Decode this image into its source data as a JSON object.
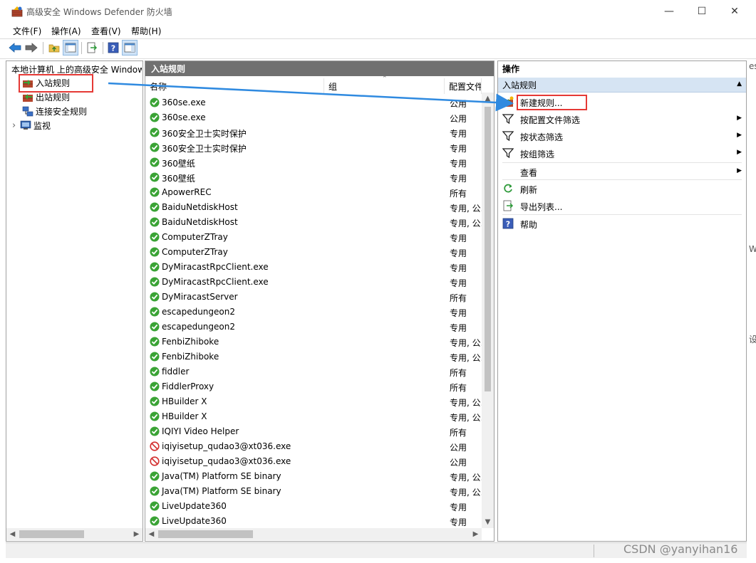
{
  "window": {
    "title": "高级安全 Windows Defender 防火墙",
    "minimize_glyph": "—",
    "maximize_glyph": "☐",
    "close_glyph": "✕"
  },
  "menu": [
    {
      "label": "文件(F)"
    },
    {
      "label": "操作(A)"
    },
    {
      "label": "查看(V)"
    },
    {
      "label": "帮助(H)"
    }
  ],
  "tree": {
    "root": "本地计算机 上的高级安全 Windows Defender 防火墙",
    "items": [
      {
        "label": "入站规则"
      },
      {
        "label": "出站规则"
      },
      {
        "label": "连接安全规则"
      },
      {
        "label": "监视"
      }
    ],
    "expander_glyph": "›"
  },
  "rules_pane": {
    "title": "入站规则",
    "columns": {
      "name": "名称",
      "group": "组",
      "profile": "配置文件"
    },
    "rows": [
      {
        "name": "360se.exe",
        "profile": "公用",
        "status": "allow"
      },
      {
        "name": "360se.exe",
        "profile": "公用",
        "status": "allow"
      },
      {
        "name": "360安全卫士实时保护",
        "profile": "专用",
        "status": "allow"
      },
      {
        "name": "360安全卫士实时保护",
        "profile": "专用",
        "status": "allow"
      },
      {
        "name": "360壁纸",
        "profile": "专用",
        "status": "allow"
      },
      {
        "name": "360壁纸",
        "profile": "专用",
        "status": "allow"
      },
      {
        "name": "ApowerREC",
        "profile": "所有",
        "status": "allow"
      },
      {
        "name": "BaiduNetdiskHost",
        "profile": "专用, 公...",
        "status": "allow"
      },
      {
        "name": "BaiduNetdiskHost",
        "profile": "专用, 公...",
        "status": "allow"
      },
      {
        "name": "ComputerZTray",
        "profile": "专用",
        "status": "allow"
      },
      {
        "name": "ComputerZTray",
        "profile": "专用",
        "status": "allow"
      },
      {
        "name": "DyMiracastRpcClient.exe",
        "profile": "专用",
        "status": "allow"
      },
      {
        "name": "DyMiracastRpcClient.exe",
        "profile": "专用",
        "status": "allow"
      },
      {
        "name": "DyMiracastServer",
        "profile": "所有",
        "status": "allow"
      },
      {
        "name": "escapedungeon2",
        "profile": "专用",
        "status": "allow"
      },
      {
        "name": "escapedungeon2",
        "profile": "专用",
        "status": "allow"
      },
      {
        "name": "FenbiZhiboke",
        "profile": "专用, 公...",
        "status": "allow"
      },
      {
        "name": "FenbiZhiboke",
        "profile": "专用, 公...",
        "status": "allow"
      },
      {
        "name": "fiddler",
        "profile": "所有",
        "status": "allow"
      },
      {
        "name": "FiddlerProxy",
        "profile": "所有",
        "status": "allow"
      },
      {
        "name": "HBuilder X",
        "profile": "专用, 公...",
        "status": "allow"
      },
      {
        "name": "HBuilder X",
        "profile": "专用, 公...",
        "status": "allow"
      },
      {
        "name": "IQIYI Video Helper",
        "profile": "所有",
        "status": "allow"
      },
      {
        "name": "iqiyisetup_qudao3@xt036.exe",
        "profile": "公用",
        "status": "block"
      },
      {
        "name": "iqiyisetup_qudao3@xt036.exe",
        "profile": "公用",
        "status": "block"
      },
      {
        "name": "Java(TM) Platform SE binary",
        "profile": "专用, 公...",
        "status": "allow"
      },
      {
        "name": "Java(TM) Platform SE binary",
        "profile": "专用, 公...",
        "status": "allow"
      },
      {
        "name": "LiveUpdate360",
        "profile": "专用",
        "status": "allow"
      },
      {
        "name": "LiveUpdate360",
        "profile": "专用",
        "status": "allow"
      }
    ]
  },
  "actions_pane": {
    "title": "操作",
    "section": "入站规则",
    "items": [
      {
        "label": "新建规则...",
        "icon": "new-rule-icon",
        "submenu": false
      },
      {
        "label": "按配置文件筛选",
        "icon": "filter-icon",
        "submenu": true
      },
      {
        "label": "按状态筛选",
        "icon": "filter-icon",
        "submenu": true
      },
      {
        "label": "按组筛选",
        "icon": "filter-icon",
        "submenu": true
      },
      {
        "label": "查看",
        "icon": "",
        "submenu": true
      },
      {
        "label": "刷新",
        "icon": "refresh-icon",
        "submenu": false
      },
      {
        "label": "导出列表...",
        "icon": "export-icon",
        "submenu": false
      },
      {
        "label": "帮助",
        "icon": "help-icon",
        "submenu": false
      }
    ]
  },
  "edge_fragments": [
    "es",
    "W",
    "设"
  ],
  "watermark": "CSDN @yanyihan16",
  "colors": {
    "header_bg": "#707070",
    "section_bg": "#d6e4f3",
    "highlight": "#e53935",
    "allow_green": "#3aa335",
    "block_red": "#d32f2f",
    "arrow_blue": "#2f8ae0"
  }
}
